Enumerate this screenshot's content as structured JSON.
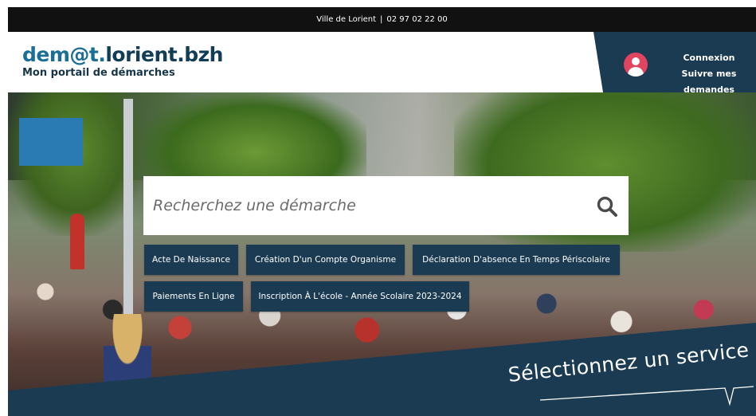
{
  "topbar": {
    "city": "Ville de Lorient",
    "separator": "|",
    "phone": "02 97 02 22 00"
  },
  "header": {
    "logo": {
      "part1": "dem@t.",
      "part2": "lorient.bzh",
      "subtitle": "Mon portail de démarches"
    },
    "account": {
      "login_label": "Connexion",
      "requests_label": "Suivre mes demandes"
    }
  },
  "search": {
    "placeholder": "Recherchez une démarche",
    "icon": "search-icon"
  },
  "quick_links": [
    {
      "label": "Acte De Naissance"
    },
    {
      "label": "Création D'un Compte Organisme"
    },
    {
      "label": "Déclaration D'absence En Temps Périscolaire"
    },
    {
      "label": "Paiements En Ligne"
    },
    {
      "label": "Inscription À L'école - Année Scolaire 2023-2024"
    }
  ],
  "band": {
    "title": "Sélectionnez un service"
  },
  "colors": {
    "navy": "#1b3b52",
    "brand_blue": "#1b6f97",
    "avatar_pink": "#e2445f",
    "topbar": "#111111"
  }
}
